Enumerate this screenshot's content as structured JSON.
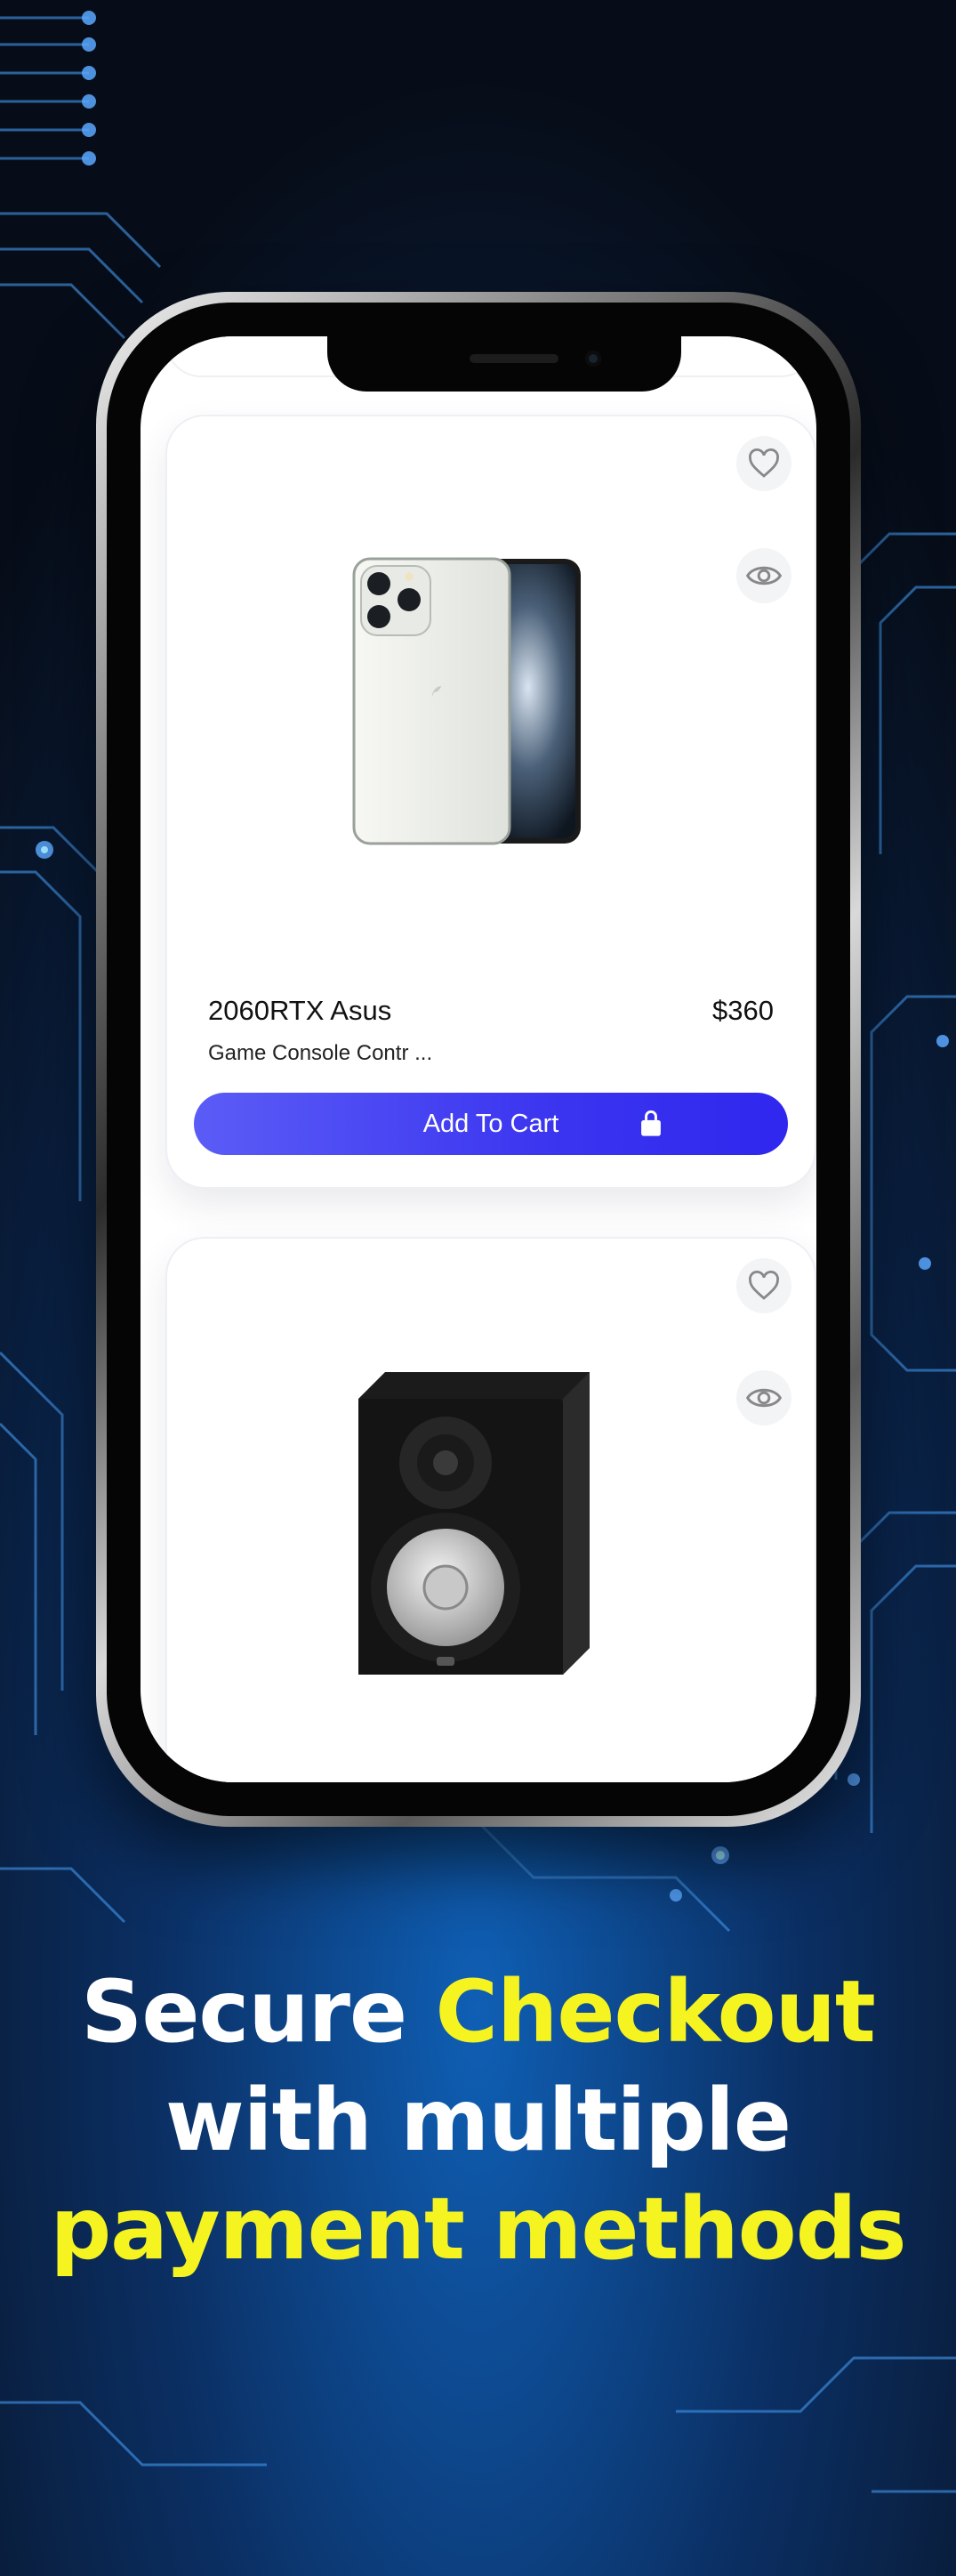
{
  "colors": {
    "accent_yellow": "#f6f420",
    "button_blue": "#3b35f0",
    "headline_white": "#ffffff",
    "background_dark": "#0a1220"
  },
  "products": [
    {
      "name": "2060RTX Asus",
      "price": "$360",
      "subtitle": "Game Console Contr ...",
      "button_label": "Add To Cart",
      "image_icon": "smartphone-image",
      "favorite_icon": "heart-icon",
      "view_icon": "eye-icon",
      "cart_icon": "shopping-bag-icon"
    },
    {
      "image_icon": "studio-speaker-image",
      "favorite_icon": "heart-icon",
      "view_icon": "eye-icon"
    }
  ],
  "headline": {
    "line1_white": "Secure",
    "line1_yellow": "Checkout",
    "line2_white": "with multiple",
    "line3_yellow": "payment methods"
  }
}
